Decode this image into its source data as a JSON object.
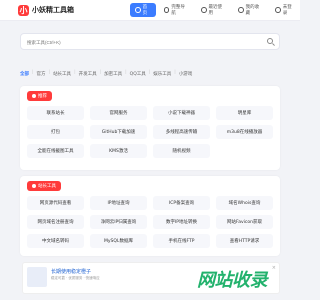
{
  "header": {
    "logo_mark": "小",
    "logo_text": "小妖精工具箱",
    "nav": [
      {
        "label": "首页",
        "active": true
      },
      {
        "label": "完整导航"
      },
      {
        "label": "最近使用"
      },
      {
        "label": "我的收藏"
      },
      {
        "label": "未登录"
      }
    ]
  },
  "search": {
    "placeholder": "搜索工具(Ctrl+K)"
  },
  "categories": [
    "全部",
    "官方",
    "站长工具",
    "开发工具",
    "加密工具",
    "QQ工具",
    "娱乐工具",
    "小游戏"
  ],
  "sections": [
    {
      "badge": "推荐",
      "tiles": [
        "联系站长",
        "官网服务",
        "小说下载神器",
        "明星库",
        "打包",
        "GitHub下载加速",
        "多线程高速传输",
        "m3u8在线播放器",
        "全能在线截图工具",
        "KMS激活",
        "随机视频"
      ]
    },
    {
      "badge": "站长工具",
      "tiles": [
        "网页源代码查看",
        "IP地址查询",
        "ICP备案查询",
        "域名Whois查询",
        "网页域名注册查询",
        "净网云IP归属查询",
        "数字IP地址转换",
        "网站Favicon获取",
        "中文域名转码",
        "MySQL数据库",
        "手机在线FTP",
        "查看HTTP请求"
      ]
    }
  ],
  "ad": {
    "title": "长期使用稳定橙子",
    "subtitle": "稳定可靠 · 优质服务 · 快速响应",
    "brand": "网站收录"
  },
  "colors": {
    "accent": "#3b7cff",
    "brand": "#ff3b3b"
  }
}
